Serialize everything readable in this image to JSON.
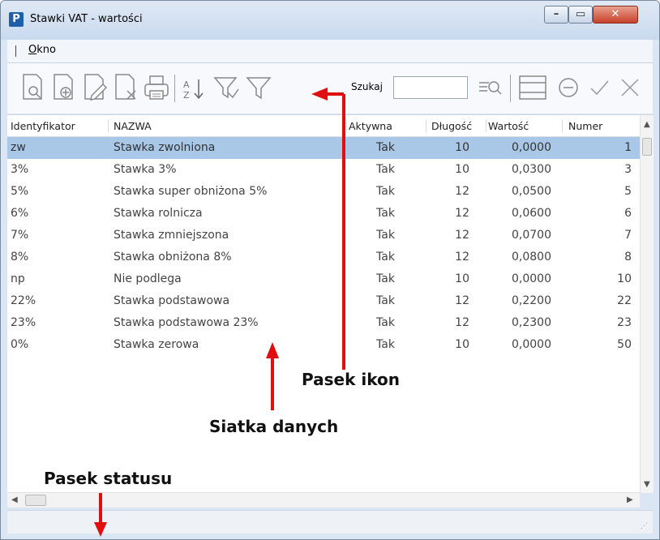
{
  "window": {
    "title": "Stawki VAT - wartości",
    "app_icon": "P"
  },
  "menu": {
    "items": [
      {
        "label": "Okno"
      }
    ]
  },
  "toolbar": {
    "search_label": "Szukaj",
    "search_value": "",
    "icons": [
      "view-document-icon",
      "add-document-icon",
      "edit-document-icon",
      "delete-document-icon",
      "print-icon",
      "sort-az-icon",
      "filter-clear-icon",
      "filter-icon",
      "search-filter-icon",
      "grid-layout-icon",
      "cancel-circle-icon",
      "confirm-check-icon",
      "close-x-icon"
    ]
  },
  "grid": {
    "columns": [
      "Identyfikator",
      "NAZWA",
      "Aktywna",
      "Długość",
      "Wartość",
      "Numer"
    ],
    "rows": [
      {
        "id": "zw",
        "name": "Stawka zwolniona",
        "active": "Tak",
        "length": "10",
        "value": "0,0000",
        "number": "1"
      },
      {
        "id": "3%",
        "name": "Stawka 3%",
        "active": "Tak",
        "length": "10",
        "value": "0,0300",
        "number": "3"
      },
      {
        "id": "5%",
        "name": "Stawka super obniżona 5%",
        "active": "Tak",
        "length": "12",
        "value": "0,0500",
        "number": "5"
      },
      {
        "id": "6%",
        "name": "Stawka rolnicza",
        "active": "Tak",
        "length": "12",
        "value": "0,0600",
        "number": "6"
      },
      {
        "id": "7%",
        "name": "Stawka zmniejszona",
        "active": "Tak",
        "length": "12",
        "value": "0,0700",
        "number": "7"
      },
      {
        "id": "8%",
        "name": "Stawka obniżona 8%",
        "active": "Tak",
        "length": "12",
        "value": "0,0800",
        "number": "8"
      },
      {
        "id": "np",
        "name": "Nie podlega",
        "active": "Tak",
        "length": "10",
        "value": "0,0000",
        "number": "10"
      },
      {
        "id": "22%",
        "name": "Stawka podstawowa",
        "active": "Tak",
        "length": "12",
        "value": "0,2200",
        "number": "22"
      },
      {
        "id": "23%",
        "name": "Stawka podstawowa 23%",
        "active": "Tak",
        "length": "12",
        "value": "0,2300",
        "number": "23"
      },
      {
        "id": "0%",
        "name": "Stawka zerowa",
        "active": "Tak",
        "length": "10",
        "value": "0,0000",
        "number": "50"
      }
    ],
    "selected_row": 0
  },
  "annotations": {
    "toolbar_label": "Pasek ikon",
    "grid_label": "Siatka danych",
    "status_label": "Pasek statusu",
    "arrow_color": "#e01010"
  },
  "colors": {
    "selected_row": "#a9c8e8",
    "title_gradient_top": "#dfe9f5",
    "close_button": "#c7422c"
  }
}
